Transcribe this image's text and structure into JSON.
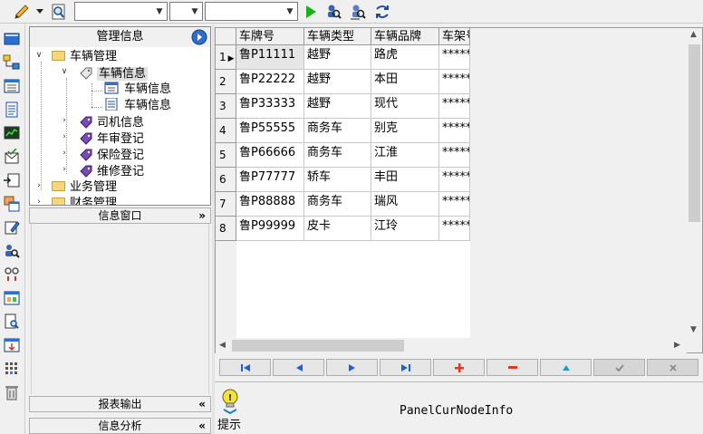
{
  "toolbar": {
    "icons": [
      "pencil-icon",
      "find-page-icon",
      "run-icon",
      "search-user-icon",
      "search-user-alt-icon",
      "refresh-link-icon"
    ]
  },
  "tree": {
    "header": "管理信息",
    "nodes": {
      "vehicle_mgmt": "车辆管理",
      "vehicle_info": "车辆信息",
      "vehicle_info_sub1": "车辆信息",
      "vehicle_info_sub2": "车辆信息",
      "driver_info": "司机信息",
      "annual_check": "年审登记",
      "insurance": "保险登记",
      "repair": "维修登记",
      "business_mgmt": "业务管理",
      "finance_mgmt": "财务管理"
    }
  },
  "panels": {
    "info_window": "信息窗口",
    "report_output": "报表输出",
    "info_analysis": "信息分析"
  },
  "grid": {
    "columns": [
      "车牌号",
      "车辆类型",
      "车辆品牌",
      "车架号"
    ],
    "rows": [
      {
        "n": "1",
        "plate": "鲁P11111",
        "type": "越野",
        "brand": "路虎",
        "frame": "*****"
      },
      {
        "n": "2",
        "plate": "鲁P22222",
        "type": "越野",
        "brand": "本田",
        "frame": "*****"
      },
      {
        "n": "3",
        "plate": "鲁P33333",
        "type": "越野",
        "brand": "现代",
        "frame": "*****"
      },
      {
        "n": "4",
        "plate": "鲁P55555",
        "type": "商务车",
        "brand": "别克",
        "frame": "*****"
      },
      {
        "n": "5",
        "plate": "鲁P66666",
        "type": "商务车",
        "brand": "江淮",
        "frame": "*****"
      },
      {
        "n": "6",
        "plate": "鲁P77777",
        "type": "轿车",
        "brand": "丰田",
        "frame": "*****"
      },
      {
        "n": "7",
        "plate": "鲁P88888",
        "type": "商务车",
        "brand": "瑞风",
        "frame": "*****"
      },
      {
        "n": "8",
        "plate": "鲁P99999",
        "type": "皮卡",
        "brand": "江玲",
        "frame": "*****"
      }
    ]
  },
  "bottom": {
    "tip": "提示",
    "current_node": "PanelCurNodeInfo"
  },
  "colors": {
    "nav_blue": "#1e5fd6",
    "nav_red": "#e03a1e",
    "nav_teal": "#1e9bb8",
    "run_green": "#17b317"
  }
}
